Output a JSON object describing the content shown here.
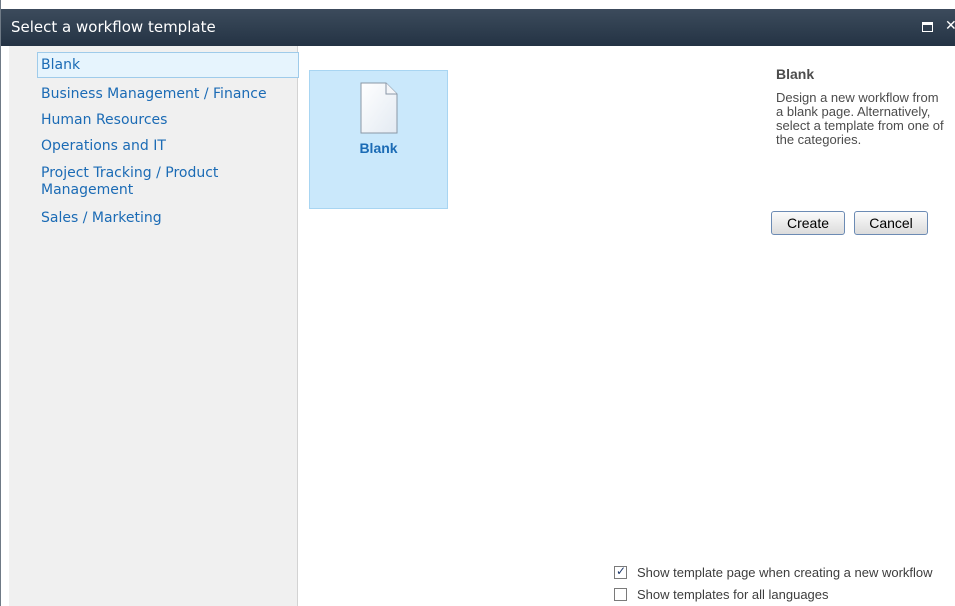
{
  "window": {
    "title": "Select a workflow template"
  },
  "categories": [
    {
      "label": "Blank"
    },
    {
      "label": "Business Management / Finance"
    },
    {
      "label": "Human Resources"
    },
    {
      "label": "Operations and IT"
    },
    {
      "label": "Project Tracking / Product Management"
    },
    {
      "label": "Sales / Marketing"
    }
  ],
  "templates": [
    {
      "label": "Blank",
      "icon": "blank-page-icon"
    }
  ],
  "details": {
    "title": "Blank",
    "description": "Design a new workflow from a blank page. Alternatively, select a template from one of the categories."
  },
  "buttons": {
    "create": "Create",
    "cancel": "Cancel"
  },
  "options": [
    {
      "label": "Show template page when creating a new workflow",
      "checked": true
    },
    {
      "label": "Show templates for all languages",
      "checked": false
    }
  ]
}
